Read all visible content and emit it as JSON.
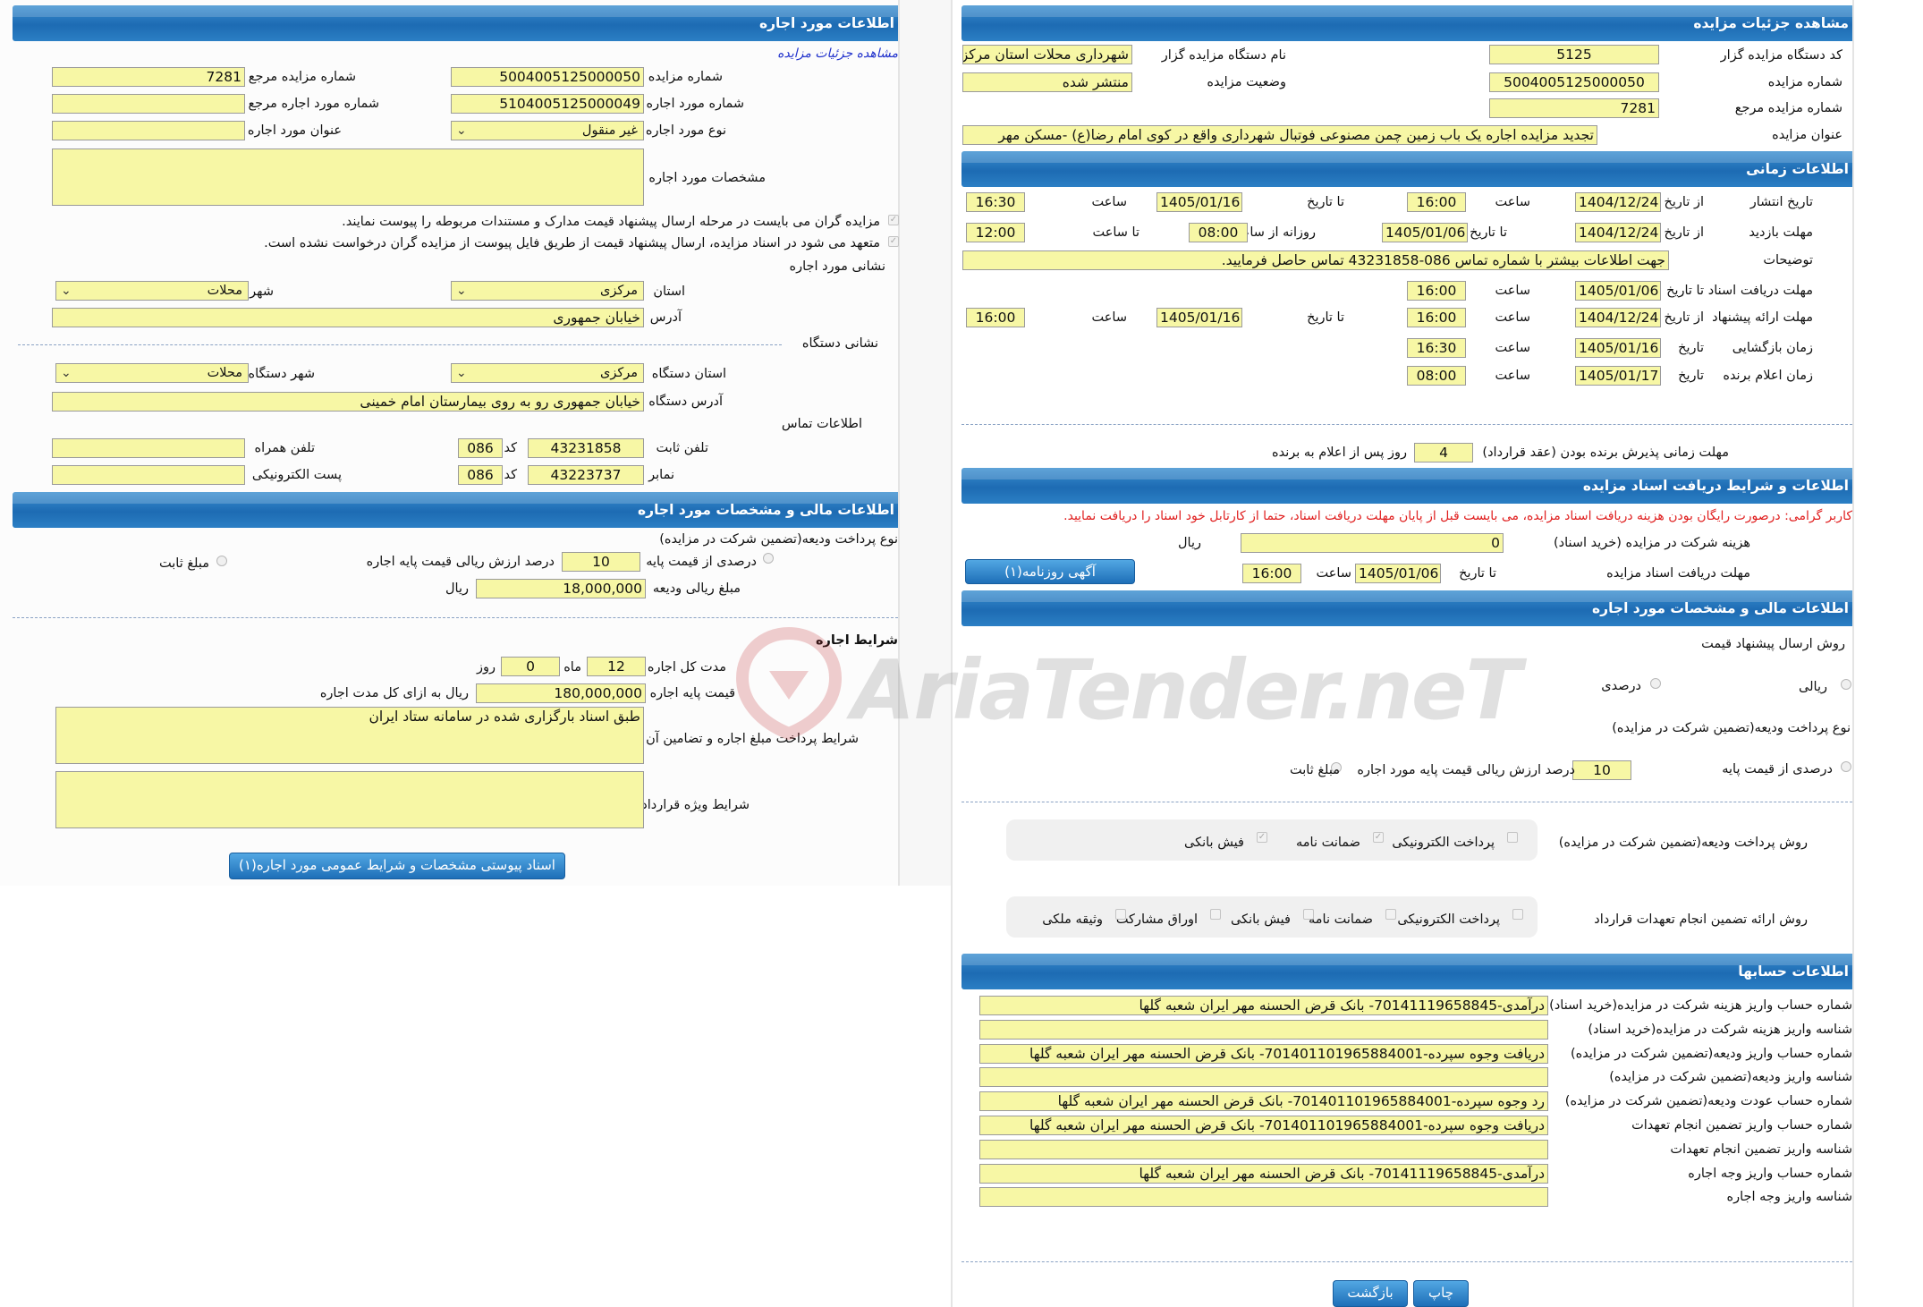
{
  "right": {
    "auction_details": {
      "title": "مشاهده جزئیات مزایده",
      "org_code_label": "کد دستگاه مزایده گزار",
      "org_code": "5125",
      "org_name_label": "نام دستگاه مزایده گزار",
      "org_name": "شهرداری محلات استان مرکزی",
      "auction_no_label": "شماره مزایده",
      "auction_no": "5004005125000050",
      "status_label": "وضعیت مزایده",
      "status": "منتشر شده",
      "ref_no_label": "شماره مزایده مرجع",
      "ref_no": "7281",
      "auction_title_label": "عنوان مزایده",
      "auction_title": "تجدید مزایده اجاره یک باب زمین چمن مصنوعی فوتبال شهرداری واقع در   کوی امام رضا(ع) -مسکن مهر"
    },
    "timing": {
      "title": "اطلاعات زمانی",
      "publish_label": "تاریخ انتشار",
      "from_date": "از تاریخ",
      "to_date": "تا تاریخ",
      "time": "ساعت",
      "to_time": "تا ساعت",
      "daily_from": "روزانه از ساعت",
      "publish_from": "1404/12/24",
      "publish_from_time": "16:00",
      "publish_to": "1405/01/16",
      "publish_to_time": "16:30",
      "visit_label": "مهلت بازدید",
      "visit_from": "1404/12/24",
      "visit_to": "1405/01/06",
      "visit_daily_from": "08:00",
      "visit_to_time": "12:00",
      "desc_label": "توضیحات",
      "desc": "جهت اطلاعات بیشتر با شماره تماس 086-43231858 تماس حاصل فرمایید.",
      "doc_deadline_label": "مهلت دریافت اسناد",
      "doc_deadline": "1405/01/06",
      "doc_deadline_time": "16:00",
      "offer_label": "مهلت ارائه پیشنهاد",
      "offer_from": "1404/12/24",
      "offer_from_time": "16:00",
      "offer_to": "1405/01/16",
      "offer_to_time": "16:00",
      "opening_label": "زمان بازگشایی",
      "date": "تاریخ",
      "opening_date": "1405/01/16",
      "opening_time": "16:30",
      "winner_label": "زمان اعلام برنده",
      "winner_date": "1405/01/17",
      "winner_time": "08:00",
      "accept_label": "مهلت زمانی پذیرش برنده بودن (عقد قرارداد)",
      "accept_days": "4",
      "accept_suffix": "روز پس از اعلام به برنده"
    },
    "docs": {
      "title": "اطلاعات و شرایط دریافت اسناد مزایده",
      "warning": "کاربر گرامی: درصورت رایگان بودن هزینه دریافت اسناد مزایده، می بایست قبل از پایان مهلت دریافت اسناد، حتما از کارتابل خود اسناد را دریافت نمایید.",
      "fee_label": "هزینه شرکت در مزایده (خرید اسناد)",
      "fee": "0",
      "rial": "ریال",
      "deadline_label": "مهلت دریافت اسناد مزایده",
      "to_date": "تا تاریخ",
      "deadline": "1405/01/06",
      "time": "ساعت",
      "deadline_time": "16:00",
      "ad_button": "آگهی روزنامه(۱)"
    },
    "financial": {
      "title": "اطلاعات مالی و مشخصات مورد اجاره",
      "offer_method_label": "روش ارسال پیشنهاد قیمت",
      "rial_opt": "ریالی",
      "percent_opt": "درصدی",
      "deposit_type_label": "نوع پرداخت ودیعه(تضمین شرکت در مزایده)",
      "pct_base_label": "درصدی از قیمت پایه",
      "pct_value": "10",
      "pct_text": "درصد ارزش ریالی قیمت پایه مورد اجاره",
      "fixed_opt": "مبلغ ثابت",
      "deposit_methods_label": "روش پرداخت ودیعه(تضمین شرکت در مزایده)",
      "dm_electronic": "پرداخت الکترونیکی",
      "dm_guarantee": "ضمانت نامه",
      "dm_bank": "فیش بانکی",
      "contract_methods_label": "روش ارائه تضمین انجام تعهدات قرارداد",
      "cm_electronic": "پرداخت الکترونیکی",
      "cm_guarantee": "ضمانت نامه",
      "cm_bank": "فیش بانکی",
      "cm_bonds": "اوراق مشارکت",
      "cm_property": "وثیقه ملکی"
    },
    "accounts": {
      "title": "اطلاعات حسابها",
      "rows": [
        {
          "label": "شماره حساب واریز هزینه شرکت در مزایده(خرید اسناد)",
          "value": "درآمدی-70141119658845- بانک قرض الحسنه مهر ایران شعبه گلها"
        },
        {
          "label": "شناسه واریز هزینه شرکت در مزایده(خرید اسناد)",
          "value": ""
        },
        {
          "label": "شماره حساب واریز ودیعه(تضمین شرکت در مزایده)",
          "value": "دریافت وجوه سپرده-701401101965884001- بانک قرض الحسنه مهر ایران شعبه گلها"
        },
        {
          "label": "شناسه واریز ودیعه(تضمین شرکت در مزایده)",
          "value": ""
        },
        {
          "label": "شماره حساب عودت ودیعه(تضمین شرکت در مزایده)",
          "value": "رد وجوه سپرده-701401101965884001- بانک قرض الحسنه مهر ایران شعبه گلها"
        },
        {
          "label": "شماره حساب واریز تضمین انجام تعهدات",
          "value": "دریافت وجوه سپرده-701401101965884001- بانک قرض الحسنه مهر ایران شعبه گلها"
        },
        {
          "label": "شناسه واریز تضمین انجام تعهدات",
          "value": ""
        },
        {
          "label": "شماره حساب واریز وجه اجاره",
          "value": "درآمدی-70141119658845- بانک قرض الحسنه مهر ایران شعبه گلها"
        },
        {
          "label": "شناسه واریز وجه اجاره",
          "value": ""
        }
      ]
    },
    "buttons": {
      "print": "چاپ",
      "back": "بازگشت"
    }
  },
  "left": {
    "lease_info": {
      "title": "اطلاعات مورد اجاره",
      "view_link": "مشاهده جزئیات مزایده",
      "auction_no_label": "شماره مزایده",
      "auction_no": "5004005125000050",
      "ref_no_label": "شماره مزایده مرجع",
      "ref_no": "7281",
      "lease_no_label": "شماره مورد اجاره",
      "lease_no": "5104005125000049",
      "lease_ref_label": "شماره مورد اجاره مرجع",
      "lease_ref": "",
      "lease_type_label": "نوع مورد اجاره",
      "lease_type": "غیر منقول",
      "lease_title_label": "عنوان مورد اجاره",
      "lease_title": "",
      "spec_label": "مشخصات مورد اجاره",
      "spec": "",
      "note1": "مزایده گران می بایست در مرحله ارسال پیشنهاد قیمت مدارک و مستندات مربوطه را پیوست نمایند.",
      "note2": "متعهد می شود در اسناد مزایده، ارسال پیشنهاد قیمت از طریق فایل پیوست از مزایده گران درخواست نشده است.",
      "address_section": "نشانی مورد اجاره",
      "province_label": "استان",
      "province": "مرکزی",
      "city_label": "شهر",
      "city": "محلات",
      "address_label": "آدرس",
      "address": "خیابان جمهوری",
      "org_address_section": "نشانی دستگاه",
      "org_province_label": "استان دستگاه",
      "org_province": "مرکزی",
      "org_city_label": "شهر دستگاه",
      "org_city": "محلات",
      "org_address_label": "آدرس دستگاه",
      "org_address": "خیابان جمهوری رو به روی بیمارستان امام خمینی",
      "contact_section": "اطلاعات تماس",
      "phone_label": "تلفن ثابت",
      "phone": "43231858",
      "code_label": "کد",
      "phone_code": "086",
      "mobile_label": "تلفن همراه",
      "mobile": "",
      "fax_label": "نمابر",
      "fax": "43223737",
      "fax_code": "086",
      "email_label": "پست الکترونیکی",
      "email": ""
    },
    "financial": {
      "title": "اطلاعات مالی و مشخصات مورد اجاره",
      "deposit_type_label": "نوع پرداخت ودیعه(تضمین شرکت در مزایده)",
      "pct_base_label": "درصدی از قیمت پایه",
      "pct_value": "10",
      "pct_text": "درصد ارزش ریالی قیمت پایه اجاره",
      "fixed_opt": "مبلغ ثابت",
      "deposit_amount_label": "مبلغ ریالی ودیعه",
      "deposit_amount": "18,000,000",
      "rial": "ریال"
    },
    "lease_terms": {
      "title": "شرایط اجاره",
      "duration_label": "مدت کل اجاره",
      "months": "12",
      "month_unit": "ماه",
      "days": "0",
      "day_unit": "روز",
      "base_price_label": "قیمت پایه اجاره",
      "base_price": "180,000,000",
      "base_price_suffix": "ریال به ازای کل مدت اجاره",
      "payment_label": "شرایط پرداخت مبلغ اجاره و تضامین آن",
      "payment": "طبق اسناد بارگزاری شده در سامانه ستاد ایران",
      "special_label": "شرایط ویژه قرارداد",
      "special": "",
      "attach_button": "اسناد پیوستی مشخصات و شرایط عمومی مورد اجاره(۱)"
    }
  },
  "watermark": "AriaTender.neT",
  "colors": {
    "header_blue": "#1d6bb3",
    "field_yellow": "#f7f7a5",
    "warning_red": "#e02020",
    "link_blue": "#2233cc"
  }
}
